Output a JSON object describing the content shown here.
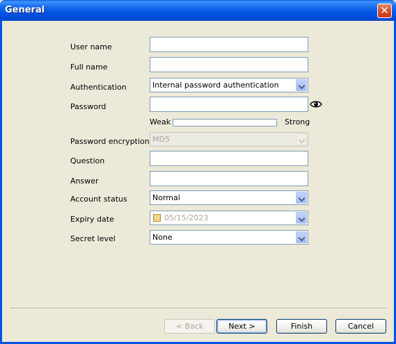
{
  "window": {
    "title": "General",
    "close_label": "✕"
  },
  "form": {
    "user_name_label": "User name",
    "user_name_value": "",
    "full_name_label": "Full name",
    "full_name_value": "",
    "authentication_label": "Authentication",
    "authentication_value": "Internal password authentication",
    "password_label": "Password",
    "password_value": "",
    "strength_weak": "Weak",
    "strength_strong": "Strong",
    "password_strength": 0,
    "password_encryption_label": "Password encryption",
    "password_encryption_value": "MD5",
    "question_label": "Question",
    "question_value": "",
    "answer_label": "Answer",
    "answer_value": "",
    "account_status_label": "Account status",
    "account_status_value": "Normal",
    "expiry_date_label": "Expiry date",
    "expiry_date_value": "05/15/2023",
    "secret_level_label": "Secret level",
    "secret_level_value": "None"
  },
  "buttons": {
    "back": "< Back",
    "next": "Next >",
    "finish": "Finish",
    "cancel": "Cancel"
  },
  "icons": {
    "eye": "eye-icon",
    "calendar": "calendar-icon",
    "close": "close-icon"
  }
}
